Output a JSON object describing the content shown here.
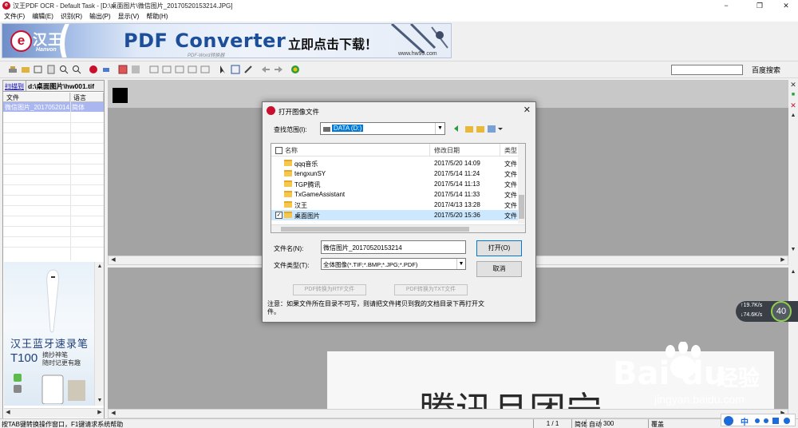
{
  "window": {
    "title": "汉王PDF OCR - Default Task - [D:\\桌面图片\\微信图片_20170520153214.JPG]",
    "minimize": "−",
    "maximize": "❐",
    "close": "✕"
  },
  "menu": [
    {
      "label": "文件(F)"
    },
    {
      "label": "编辑(E)"
    },
    {
      "label": "识别(R)"
    },
    {
      "label": "输出(P)"
    },
    {
      "label": "显示(V)"
    },
    {
      "label": "帮助(H)"
    }
  ],
  "banner": {
    "logo_text": "汉王",
    "logo_sub": "Hanvon",
    "title": "PDF Converter",
    "cta": "立即点击下载！",
    "sub": "PDF-Word转换器",
    "url": "www.hw99.com"
  },
  "toolbar": {
    "search_placeholder": "",
    "search_button": "百度搜索"
  },
  "left_panel": {
    "tab_scan": "扫描到",
    "tab_path": "d:\\桌面图片\\hw001.tif",
    "col_file": "文件",
    "col_lang": "语言",
    "files": [
      {
        "name": "微信图片_2017052014...",
        "lang": "简体"
      }
    ]
  },
  "ad": {
    "title": "汉王蓝牙速录笔",
    "model": "T100",
    "line1": "摘抄神笔",
    "line2": "随时记更有趣"
  },
  "dialog": {
    "title": "打开图像文件",
    "close": "✕",
    "lookin_label": "查找范围(I):",
    "lookin_value": "DATA (D:)",
    "columns": {
      "name": "名称",
      "date": "修改日期",
      "type": "类型"
    },
    "files": [
      {
        "name": "qqq音乐",
        "date": "2017/5/20 14:09",
        "type": "文件",
        "selected": false
      },
      {
        "name": "tengxunSY",
        "date": "2017/5/14 11:24",
        "type": "文件",
        "selected": false
      },
      {
        "name": "TGP腾讯",
        "date": "2017/5/14 11:13",
        "type": "文件",
        "selected": false
      },
      {
        "name": "TxGameAssistant",
        "date": "2017/5/14 11:33",
        "type": "文件",
        "selected": false
      },
      {
        "name": "汉王",
        "date": "2017/4/13 13:28",
        "type": "文件",
        "selected": false
      },
      {
        "name": "桌面图片",
        "date": "2017/5/20 15:36",
        "type": "文件",
        "selected": true
      }
    ],
    "filename_label": "文件名(N):",
    "filename_value": "微信图片_20170520153214",
    "filetype_label": "文件类型(T):",
    "filetype_value": "全体图像(*.TIF;*.BMP;*.JPG;*.PDF)",
    "open_button": "打开(O)",
    "cancel_button": "取消",
    "convert_rtf": "PDF转换为RTF文件",
    "convert_txt": "PDF转换为TXT文件",
    "note": "注意：如果文件所在目录不可写，则请把文件拷贝到我的文档目录下再打开文件。"
  },
  "document": {
    "text": "腾讯且团宁"
  },
  "status": {
    "help": "按TAB键转换操作窗口，F1键请求系统帮助",
    "page": "1 / 1",
    "c1": "简体",
    "c2": "自动",
    "c3": "300",
    "c4": "覆盖"
  },
  "overlays": {
    "net_up": "↑19.7K/s",
    "net_down": "↓74.6K/s",
    "net_value": "40",
    "watermark_logo": "Bai du",
    "watermark_cn": "经验",
    "watermark_url": "jingyan.baidu.com",
    "ime_text": "中"
  }
}
